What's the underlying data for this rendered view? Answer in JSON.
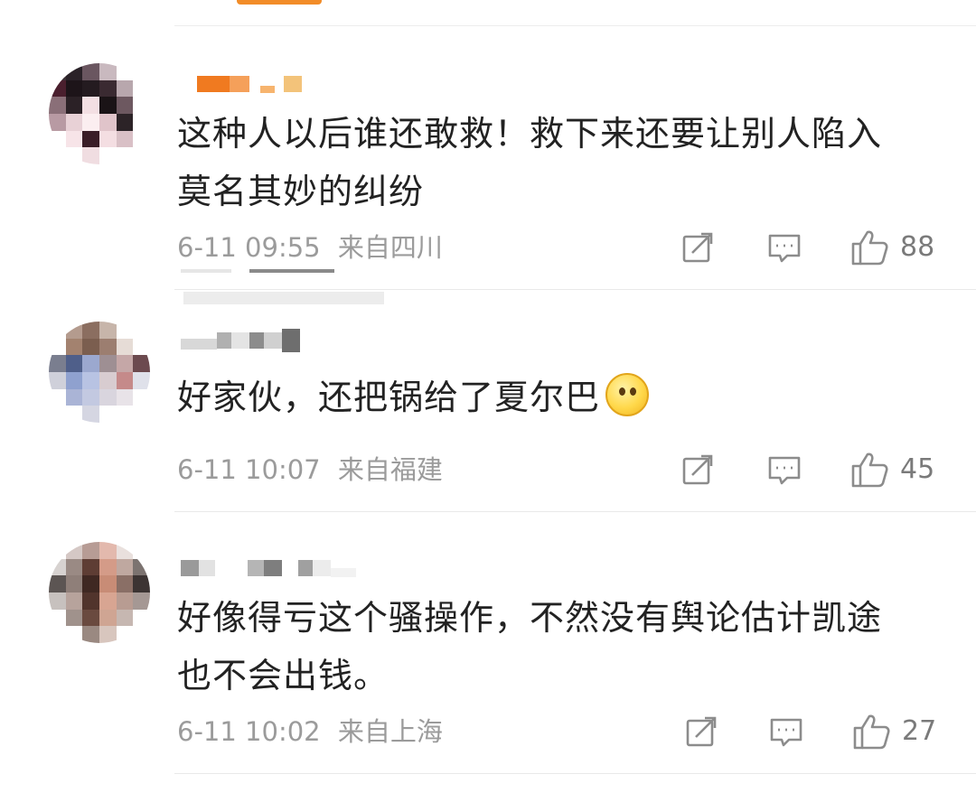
{
  "colors": {
    "accent": "#f28c28",
    "text": "#222222",
    "meta": "#9b9b9b",
    "divider": "#e9e9e9"
  },
  "comments": [
    {
      "text_line1": "这种人以后谁还敢救！救下来还要让别人陷入",
      "text_line2": "莫名其妙的纠纷",
      "date": "6-11",
      "time": "09:55",
      "location": "来自四川",
      "likes": "88",
      "icons": [
        "repost-icon",
        "comment-icon",
        "like-icon"
      ]
    },
    {
      "text_line1": "好家伙，还把锅给了夏尔巴",
      "emoji": "thinking-emoji",
      "date": "6-11",
      "time": "10:07",
      "location": "来自福建",
      "likes": "45",
      "icons": [
        "repost-icon",
        "comment-icon",
        "like-icon"
      ]
    },
    {
      "text_line1": "好像得亏这个骚操作，不然没有舆论估计凯途",
      "text_line2": "也不会出钱。",
      "date": "6-11",
      "time": "10:02",
      "location": "来自上海",
      "likes": "27",
      "icons": [
        "repost-icon",
        "comment-icon",
        "like-icon"
      ]
    }
  ]
}
